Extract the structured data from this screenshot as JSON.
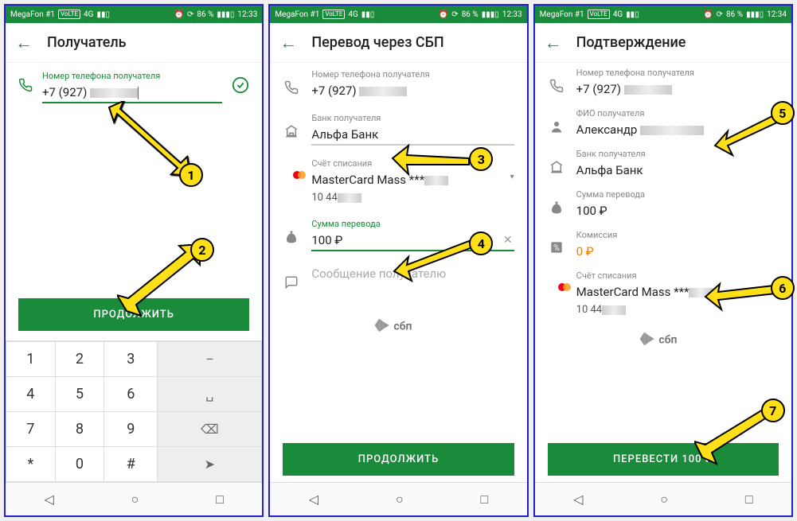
{
  "status": {
    "carrier": "MegaFon #1",
    "battery": "86 %",
    "net": "4G",
    "icons": "⏰"
  },
  "time1": "12:33",
  "time2": "12:33",
  "time3": "12:34",
  "screen1": {
    "title": "Получатель",
    "phone_label": "Номер телефона получателя",
    "phone_value": "+7 (927)",
    "continue": "ПРОДОЛЖИТЬ",
    "keys": [
      "1",
      "2",
      "3",
      "4",
      "5",
      "6",
      "7",
      "8",
      "9",
      "*",
      "0",
      "#"
    ]
  },
  "screen2": {
    "title": "Перевод через СБП",
    "phone_label": "Номер телефона получателя",
    "phone_value": "+7 (927)",
    "bank_label": "Банк получателя",
    "bank_value": "Альфа Банк",
    "acct_label": "Счёт списания",
    "acct_value": "MasterCard Mass ***",
    "acct_value2": "10 44",
    "amount_label": "Сумма перевода",
    "amount_value": "100 ₽",
    "msg_label": "Сообщение получателю",
    "continue": "ПРОДОЛЖИТЬ",
    "sbp": "сбп"
  },
  "screen3": {
    "title": "Подтверждение",
    "phone_label": "Номер телефона получателя",
    "phone_value": "+7 (927)",
    "name_label": "ФИО получателя",
    "name_value": "Александр",
    "bank_label": "Банк получателя",
    "bank_value": "Альфа Банк",
    "amount_label": "Сумма перевода",
    "amount_value": "100 ₽",
    "fee_label": "Комиссия",
    "fee_value": "0 ₽",
    "acct_label": "Счёт списания",
    "acct_value": "MasterCard Mass ***",
    "acct_value2": "10 44",
    "submit": "ПЕРЕВЕСТИ 100 ₽",
    "sbp": "сбп"
  },
  "markers": {
    "m1": "1",
    "m2": "2",
    "m3": "3",
    "m4": "4",
    "m5": "5",
    "m6": "6",
    "m7": "7"
  }
}
